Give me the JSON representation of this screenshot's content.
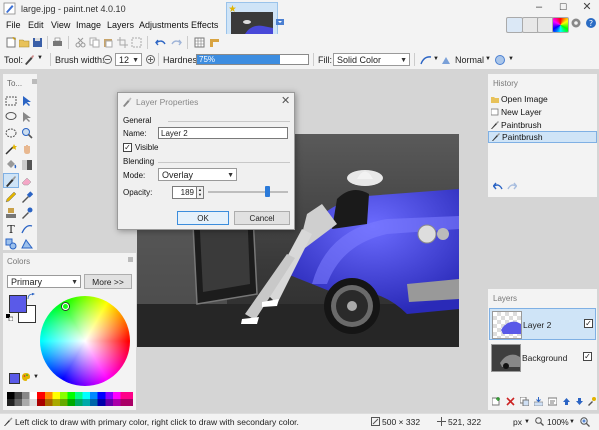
{
  "window": {
    "title": "large.jpg - paint.net 4.0.10",
    "minimize": "–",
    "maximize": "☐",
    "close": "✕"
  },
  "menu": {
    "items": [
      "File",
      "Edit",
      "View",
      "Image",
      "Layers",
      "Adjustments",
      "Effects"
    ]
  },
  "options": {
    "tool_label": "Tool:",
    "brush_width_label": "Brush width:",
    "brush_width_value": "12",
    "hardness_label": "Hardness:",
    "hardness_value": "75%",
    "hardness_fraction": 0.75,
    "fill_label": "Fill:",
    "fill_value": "Solid Color",
    "blend_mode": "Normal"
  },
  "tools": {
    "title": "To..."
  },
  "colors": {
    "title": "Colors",
    "palette_select": "Primary",
    "more_button": "More >>",
    "primary_color": "#5a5ae8",
    "secondary_color": "#ffffff"
  },
  "history": {
    "title": "History",
    "items": [
      {
        "label": "Open Image",
        "icon": "open-image-icon"
      },
      {
        "label": "New Layer",
        "icon": "new-layer-icon"
      },
      {
        "label": "Paintbrush",
        "icon": "paintbrush-icon"
      },
      {
        "label": "Paintbrush",
        "icon": "paintbrush-icon",
        "selected": true
      }
    ]
  },
  "layers": {
    "title": "Layers",
    "items": [
      {
        "label": "Layer 2",
        "visible": true,
        "selected": true
      },
      {
        "label": "Background",
        "visible": true,
        "selected": false
      }
    ]
  },
  "dialog": {
    "title": "Layer Properties",
    "general_label": "General",
    "name_label": "Name:",
    "name_value": "Layer 2",
    "visible_label": "Visible",
    "visible_checked": true,
    "blending_label": "Blending",
    "mode_label": "Mode:",
    "mode_value": "Overlay",
    "opacity_label": "Opacity:",
    "opacity_value": "189",
    "opacity_fraction": 0.74,
    "ok_label": "OK",
    "cancel_label": "Cancel"
  },
  "status": {
    "hint": "Left click to draw with primary color, right click to draw with secondary color.",
    "image_size": "500 × 332",
    "cursor_pos": "521, 322",
    "unit": "px",
    "zoom": "100%"
  }
}
